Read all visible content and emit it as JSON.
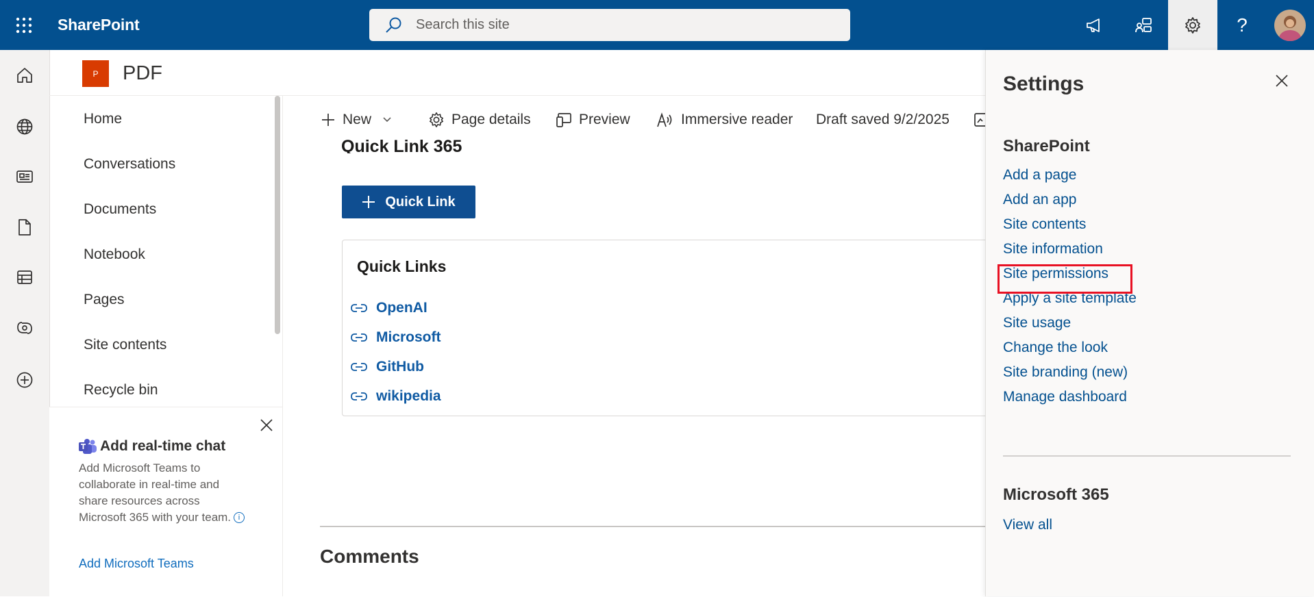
{
  "suite_bar": {
    "brand": "SharePoint",
    "search_placeholder": "Search this site",
    "icons": [
      "waffle-icon",
      "megaphone-icon",
      "feedback-icon",
      "gear-icon",
      "help-icon"
    ],
    "help_glyph": "?"
  },
  "app_bar": {
    "icons": [
      "home-icon",
      "globe-icon",
      "news-icon",
      "file-icon",
      "list-icon",
      "loop-icon",
      "add-icon"
    ]
  },
  "site": {
    "logo_letter": "P",
    "title": "PDF"
  },
  "left_nav": {
    "items": [
      {
        "label": "Home"
      },
      {
        "label": "Conversations"
      },
      {
        "label": "Documents"
      },
      {
        "label": "Notebook"
      },
      {
        "label": "Pages"
      },
      {
        "label": "Site contents"
      },
      {
        "label": "Recycle bin"
      }
    ]
  },
  "teams_card": {
    "title": "Add real-time chat",
    "body": "Add Microsoft Teams to collaborate in real-time and share resources across Microsoft 365 with your team.",
    "info_glyph": "i",
    "link": "Add Microsoft Teams"
  },
  "command_bar": {
    "new": "New",
    "page_details": "Page details",
    "preview": "Preview",
    "immersive_reader": "Immersive reader",
    "draft_status": "Draft saved 9/2/2025"
  },
  "content": {
    "section_title": "Quick Link 365",
    "quick_link_button": "Quick Link",
    "quick_links_title": "Quick Links",
    "links": [
      {
        "label": "OpenAI"
      },
      {
        "label": "Microsoft"
      },
      {
        "label": "GitHub"
      },
      {
        "label": "wikipedia"
      }
    ],
    "comments_title": "Comments"
  },
  "settings_panel": {
    "title": "Settings",
    "sharepoint_heading": "SharePoint",
    "links": [
      {
        "label": "Add a page"
      },
      {
        "label": "Add an app"
      },
      {
        "label": "Site contents"
      },
      {
        "label": "Site information"
      },
      {
        "label": "Site permissions",
        "highlighted": true
      },
      {
        "label": "Apply a site template"
      },
      {
        "label": "Site usage"
      },
      {
        "label": "Change the look"
      },
      {
        "label": "Site branding (new)"
      },
      {
        "label": "Manage dashboard"
      }
    ],
    "m365_heading": "Microsoft 365",
    "view_all": "View all",
    "highlight_color": "#e81123"
  },
  "colors": {
    "suite_bar": "#03508f",
    "accent": "#0f4e91",
    "link": "#03508f",
    "site_logo": "#d83b01"
  }
}
